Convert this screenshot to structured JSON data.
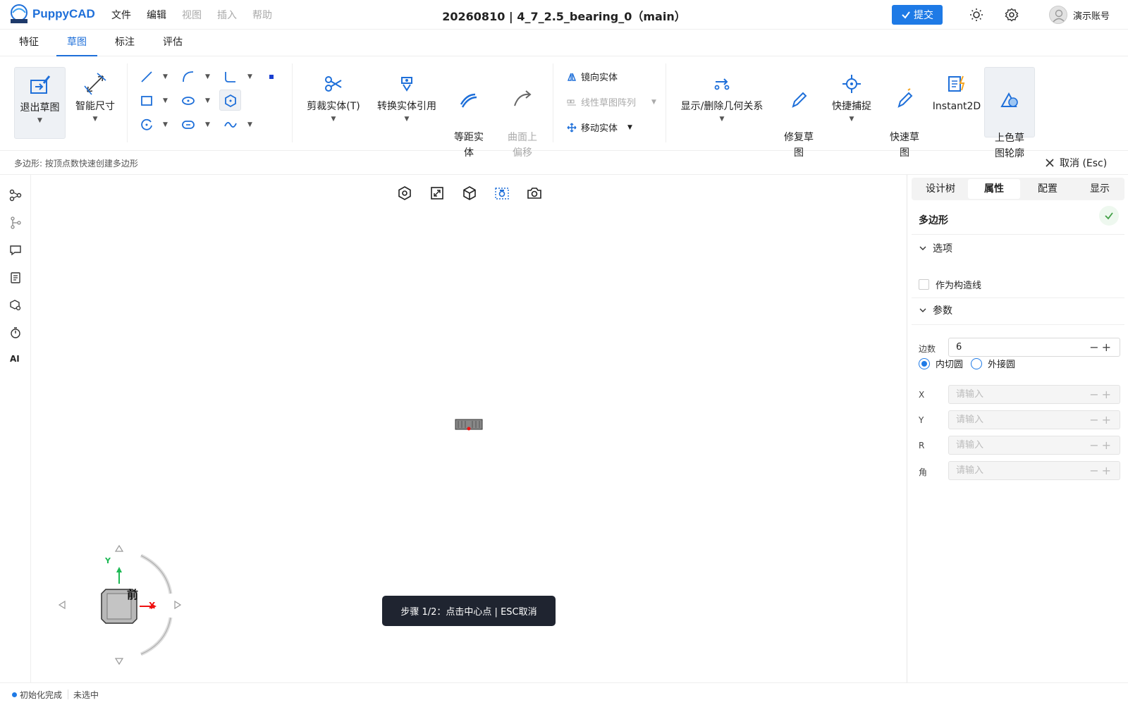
{
  "app": {
    "name": "PuppyCAD",
    "brand_color": "#1e6fd9"
  },
  "menu": [
    "文件",
    "编辑",
    "视图",
    "插入",
    "帮助"
  ],
  "doc_title": "20260810 | 4_7_2.5_bearing_0（main）",
  "header": {
    "submit_label": "提交",
    "user_name": "演示账号"
  },
  "tabs": [
    "特征",
    "草图",
    "标注",
    "评估"
  ],
  "active_tab": "草图",
  "ribbon": {
    "exit_sketch": "退出草图",
    "smart_dim": "智能尺寸",
    "trim": "剪裁实体(T)",
    "convert": "转换实体引用",
    "offset": "等距实\n体",
    "surface_offset": "曲面上\n偏移",
    "mirror": "镜向实体",
    "linear_pattern": "线性草图阵列",
    "move": "移动实体",
    "relations": "显示/删除几何关系",
    "repair": "修复草\n图",
    "snap": "快捷捕捉",
    "quick": "快速草\n图",
    "instant2d": "Instant2D",
    "shade": "上色草\n图轮廓"
  },
  "hint": {
    "text": "多边形: 按顶点数快速创建多边形",
    "cancel": "取消 (Esc)"
  },
  "toast": "步骤 1/2：点击中心点 | ESC取消",
  "view_cube": {
    "face": "前",
    "x_label": "X",
    "y_label": "Y"
  },
  "panel": {
    "tabs": [
      "设计树",
      "属性",
      "配置",
      "显示"
    ],
    "active_tab": "属性",
    "title": "多边形",
    "options_header": "选项",
    "construction_label": "作为构造线",
    "params_header": "参数",
    "sides_label": "边数",
    "sides_value": "6",
    "inscribed": "内切圆",
    "circumscribed": "外接圆",
    "fields": [
      {
        "label": "X",
        "placeholder": "请输入"
      },
      {
        "label": "Y",
        "placeholder": "请输入"
      },
      {
        "label": "R",
        "placeholder": "请输入"
      },
      {
        "label": "角",
        "placeholder": "请输入"
      }
    ]
  },
  "status": {
    "init": "初始化完成",
    "selection": "未选中"
  }
}
